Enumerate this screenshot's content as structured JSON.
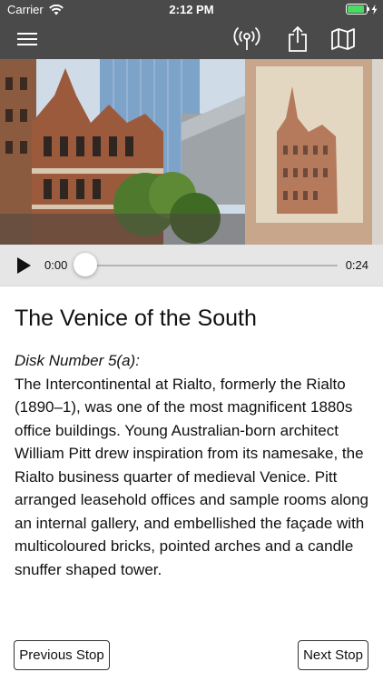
{
  "status": {
    "carrier": "Carrier",
    "time": "2:12 PM"
  },
  "navbar": {
    "menu_icon": "hamburger-menu-icon",
    "broadcast_icon": "broadcast-icon",
    "share_icon": "share-icon",
    "map_icon": "map-icon"
  },
  "player": {
    "current": "0:00",
    "duration": "0:24",
    "progress": 0
  },
  "stop": {
    "title": "The Venice of the South",
    "disk": "Disk Number 5(a):",
    "body": "The Intercontinental at Rialto, formerly the Rialto (1890–1), was one of the most magnificent 1880s office buildings. Young Australian-born architect William Pitt drew inspiration from its namesake, the Rialto business quarter of medieval Venice. Pitt arranged leasehold offices and sample rooms along an internal gallery, and embellished the façade with multicoloured bricks, pointed arches and a candle snuffer shaped tower."
  },
  "nav_buttons": {
    "previous": "Previous Stop",
    "next": "Next Stop"
  },
  "colors": {
    "bar": "#4a4a4a",
    "battery": "#4cd964",
    "player_bg": "#e6e6e6"
  }
}
